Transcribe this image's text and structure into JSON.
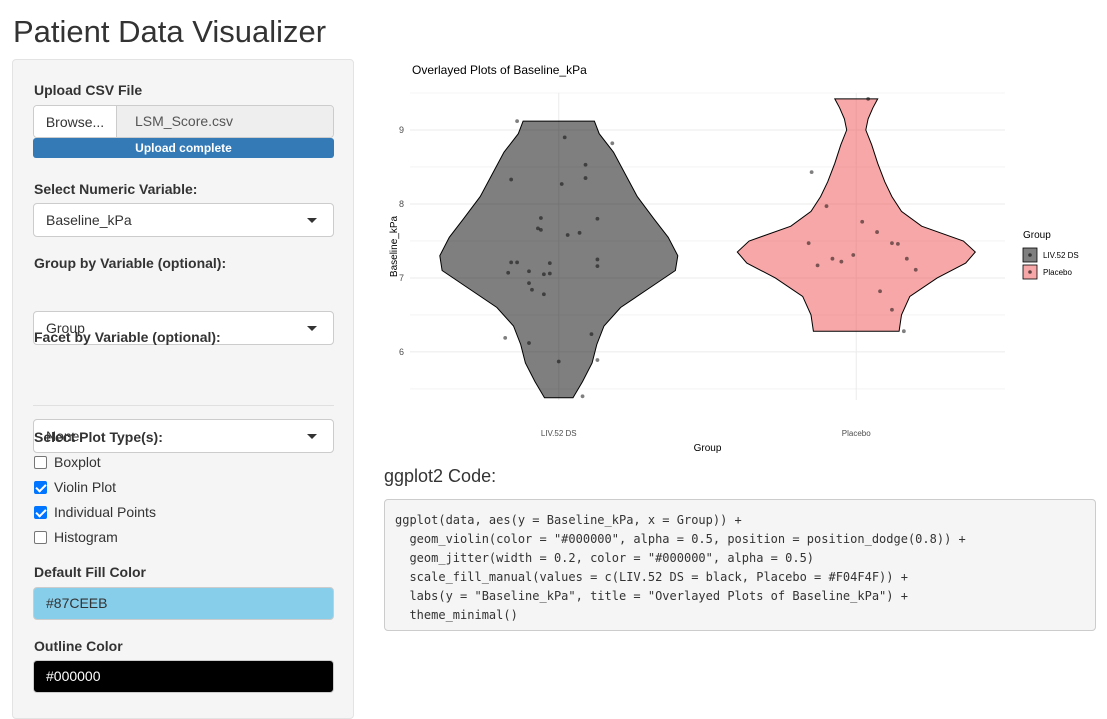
{
  "app": {
    "title": "Patient Data Visualizer"
  },
  "sidebar": {
    "upload": {
      "label": "Upload CSV File",
      "browse_label": "Browse...",
      "file_name": "LSM_Score.csv",
      "progress_text": "Upload complete",
      "progress": 1.0
    },
    "numeric_var": {
      "label": "Select Numeric Variable:",
      "value": "Baseline_kPa"
    },
    "group_var": {
      "label": "Group by Variable (optional):",
      "value": "Group"
    },
    "facet_var": {
      "label": "Facet by Variable (optional):",
      "value": "None"
    },
    "plot_types": {
      "label": "Select Plot Type(s):",
      "options": [
        {
          "label": "Boxplot",
          "checked": false
        },
        {
          "label": "Violin Plot",
          "checked": true
        },
        {
          "label": "Individual Points",
          "checked": true
        },
        {
          "label": "Histogram",
          "checked": false
        }
      ]
    },
    "fill_color": {
      "label": "Default Fill Color",
      "value": "#87CEEB"
    },
    "outline_color": {
      "label": "Outline Color",
      "value": "#000000"
    }
  },
  "chart_data": {
    "type": "violin",
    "title": "Overlayed Plots of Baseline_kPa",
    "xlabel": "Group",
    "ylabel": "Baseline_kPa",
    "categories": [
      "LIV.52 DS",
      "Placebo"
    ],
    "ylim": [
      5.35,
      9.5
    ],
    "yticks": [
      6,
      7,
      8,
      9
    ],
    "grid": true,
    "legend": {
      "title": "Group",
      "position": "right",
      "entries": [
        "LIV.52 DS",
        "Placebo"
      ]
    },
    "colors": {
      "LIV.52 DS": "#000000",
      "Placebo": "#F04F4F",
      "outline": "#000000"
    },
    "alpha": 0.5,
    "violins": [
      {
        "group": "LIV.52 DS",
        "min": 5.38,
        "max": 9.12,
        "profile": [
          [
            5.38,
            0.12
          ],
          [
            5.6,
            0.2
          ],
          [
            5.85,
            0.28
          ],
          [
            6.1,
            0.32
          ],
          [
            6.35,
            0.38
          ],
          [
            6.6,
            0.52
          ],
          [
            6.85,
            0.75
          ],
          [
            7.1,
            0.98
          ],
          [
            7.3,
            1.0
          ],
          [
            7.55,
            0.92
          ],
          [
            7.8,
            0.8
          ],
          [
            8.1,
            0.66
          ],
          [
            8.4,
            0.56
          ],
          [
            8.7,
            0.46
          ],
          [
            8.95,
            0.34
          ],
          [
            9.12,
            0.3
          ]
        ]
      },
      {
        "group": "Placebo",
        "min": 6.28,
        "max": 9.42,
        "profile": [
          [
            6.28,
            0.36
          ],
          [
            6.5,
            0.38
          ],
          [
            6.75,
            0.45
          ],
          [
            7.0,
            0.68
          ],
          [
            7.2,
            0.92
          ],
          [
            7.35,
            1.0
          ],
          [
            7.5,
            0.9
          ],
          [
            7.7,
            0.55
          ],
          [
            7.9,
            0.38
          ],
          [
            8.1,
            0.3
          ],
          [
            8.3,
            0.24
          ],
          [
            8.55,
            0.18
          ],
          [
            8.8,
            0.13
          ],
          [
            9.0,
            0.08
          ],
          [
            9.15,
            0.1
          ],
          [
            9.3,
            0.14
          ],
          [
            9.42,
            0.18
          ]
        ]
      }
    ],
    "points": [
      {
        "group": "LIV.52 DS",
        "dx": -0.14,
        "y": 9.12
      },
      {
        "group": "LIV.52 DS",
        "dx": 0.02,
        "y": 8.9
      },
      {
        "group": "LIV.52 DS",
        "dx": 0.18,
        "y": 8.82
      },
      {
        "group": "LIV.52 DS",
        "dx": 0.09,
        "y": 8.53
      },
      {
        "group": "LIV.52 DS",
        "dx": 0.09,
        "y": 8.35
      },
      {
        "group": "LIV.52 DS",
        "dx": -0.16,
        "y": 8.33
      },
      {
        "group": "LIV.52 DS",
        "dx": 0.01,
        "y": 8.27
      },
      {
        "group": "LIV.52 DS",
        "dx": -0.06,
        "y": 7.81
      },
      {
        "group": "LIV.52 DS",
        "dx": 0.13,
        "y": 7.8
      },
      {
        "group": "LIV.52 DS",
        "dx": -0.07,
        "y": 7.67
      },
      {
        "group": "LIV.52 DS",
        "dx": -0.06,
        "y": 7.65
      },
      {
        "group": "LIV.52 DS",
        "dx": 0.07,
        "y": 7.61
      },
      {
        "group": "LIV.52 DS",
        "dx": 0.03,
        "y": 7.58
      },
      {
        "group": "LIV.52 DS",
        "dx": 0.13,
        "y": 7.25
      },
      {
        "group": "LIV.52 DS",
        "dx": -0.16,
        "y": 7.21
      },
      {
        "group": "LIV.52 DS",
        "dx": -0.14,
        "y": 7.21
      },
      {
        "group": "LIV.52 DS",
        "dx": -0.03,
        "y": 7.2
      },
      {
        "group": "LIV.52 DS",
        "dx": 0.13,
        "y": 7.16
      },
      {
        "group": "LIV.52 DS",
        "dx": -0.1,
        "y": 7.09
      },
      {
        "group": "LIV.52 DS",
        "dx": -0.17,
        "y": 7.07
      },
      {
        "group": "LIV.52 DS",
        "dx": -0.05,
        "y": 7.05
      },
      {
        "group": "LIV.52 DS",
        "dx": -0.03,
        "y": 7.06
      },
      {
        "group": "LIV.52 DS",
        "dx": -0.1,
        "y": 6.93
      },
      {
        "group": "LIV.52 DS",
        "dx": -0.09,
        "y": 6.84
      },
      {
        "group": "LIV.52 DS",
        "dx": -0.05,
        "y": 6.78
      },
      {
        "group": "LIV.52 DS",
        "dx": 0.11,
        "y": 6.24
      },
      {
        "group": "LIV.52 DS",
        "dx": -0.18,
        "y": 6.19
      },
      {
        "group": "LIV.52 DS",
        "dx": -0.1,
        "y": 6.12
      },
      {
        "group": "LIV.52 DS",
        "dx": 0.13,
        "y": 5.89
      },
      {
        "group": "LIV.52 DS",
        "dx": 0.0,
        "y": 5.87
      },
      {
        "group": "LIV.52 DS",
        "dx": 0.08,
        "y": 5.4
      },
      {
        "group": "Placebo",
        "dx": 0.04,
        "y": 9.42
      },
      {
        "group": "Placebo",
        "dx": -0.15,
        "y": 8.43
      },
      {
        "group": "Placebo",
        "dx": -0.1,
        "y": 7.97
      },
      {
        "group": "Placebo",
        "dx": 0.02,
        "y": 7.76
      },
      {
        "group": "Placebo",
        "dx": 0.07,
        "y": 7.62
      },
      {
        "group": "Placebo",
        "dx": -0.16,
        "y": 7.47
      },
      {
        "group": "Placebo",
        "dx": 0.12,
        "y": 7.47
      },
      {
        "group": "Placebo",
        "dx": 0.14,
        "y": 7.46
      },
      {
        "group": "Placebo",
        "dx": -0.01,
        "y": 7.31
      },
      {
        "group": "Placebo",
        "dx": -0.08,
        "y": 7.26
      },
      {
        "group": "Placebo",
        "dx": 0.17,
        "y": 7.26
      },
      {
        "group": "Placebo",
        "dx": -0.05,
        "y": 7.22
      },
      {
        "group": "Placebo",
        "dx": -0.13,
        "y": 7.17
      },
      {
        "group": "Placebo",
        "dx": 0.2,
        "y": 7.11
      },
      {
        "group": "Placebo",
        "dx": 0.08,
        "y": 6.82
      },
      {
        "group": "Placebo",
        "dx": 0.12,
        "y": 6.57
      },
      {
        "group": "Placebo",
        "dx": 0.16,
        "y": 6.28
      }
    ]
  },
  "code": {
    "title": "ggplot2 Code:",
    "text": "ggplot(data, aes(y = Baseline_kPa, x = Group)) +\n  geom_violin(color = \"#000000\", alpha = 0.5, position = position_dodge(0.8)) +\n  geom_jitter(width = 0.2, color = \"#000000\", alpha = 0.5)\n  scale_fill_manual(values = c(LIV.52 DS = black, Placebo = #F04F4F)) +\n  labs(y = \"Baseline_kPa\", title = \"Overlayed Plots of Baseline_kPa\") +\n  theme_minimal()"
  }
}
